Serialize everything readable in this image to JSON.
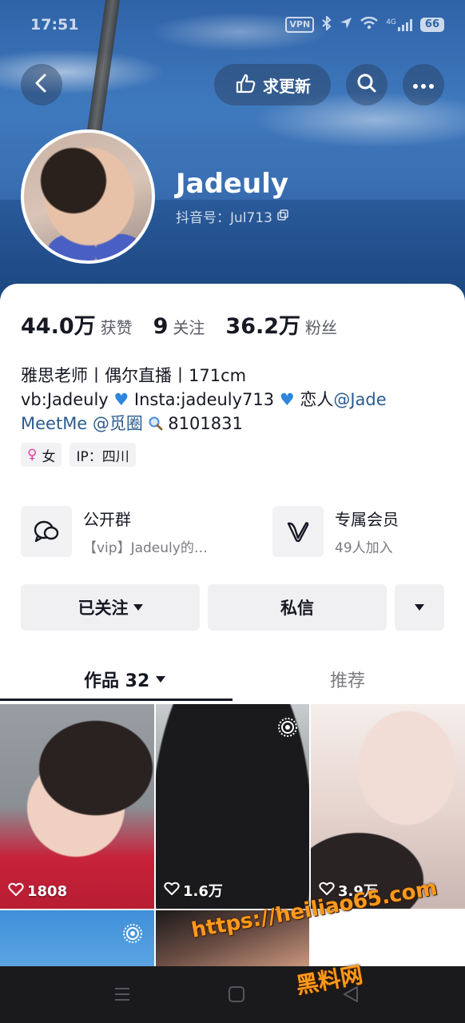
{
  "status_bar": {
    "time": "17:51",
    "vpn": "VPN",
    "network": "4G",
    "battery": "66"
  },
  "header": {
    "back_icon": "chevron-left-icon",
    "update_request_label": "求更新",
    "search_icon": "search-icon",
    "more_icon": "more-icon"
  },
  "profile": {
    "nickname": "Jadeuly",
    "douyin_id": "抖音号：Jul713",
    "stats": [
      {
        "value": "44.0万",
        "label": "获赞"
      },
      {
        "value": "9",
        "label": "关注"
      },
      {
        "value": "36.2万",
        "label": "粉丝"
      }
    ],
    "bio": {
      "line1": "雅思老师丨偶尔直播丨171cm",
      "line2_a": "vb:Jadeuly ",
      "line2_b": " Insta:jadeuly713 ",
      "line2_c": " 恋人",
      "line2_link": "@Jade",
      "line3_link1": "MeetMe",
      "line3_link2": "@觅圈",
      "line3_tail": "8101831"
    },
    "tags": {
      "gender": "女",
      "ip": "IP：四川"
    }
  },
  "features": {
    "group": {
      "title": "公开群",
      "subtitle": "【vip】Jadeuly的…"
    },
    "member": {
      "title": "专属会员",
      "subtitle": "49人加入"
    }
  },
  "actions": {
    "followed_label": "已关注",
    "message_label": "私信"
  },
  "tabs": {
    "works_label": "作品 32",
    "recommend_label": "推荐"
  },
  "videos": [
    {
      "likes": "1808"
    },
    {
      "likes": "1.6万"
    },
    {
      "likes": "3.9万"
    }
  ],
  "watermark": {
    "url": "https://heiliao65.com",
    "name": "黑料网"
  },
  "colors": {
    "link": "#2b5c8f",
    "accent_pink": "#e23fa0",
    "watermark": "#ff9a1a"
  }
}
